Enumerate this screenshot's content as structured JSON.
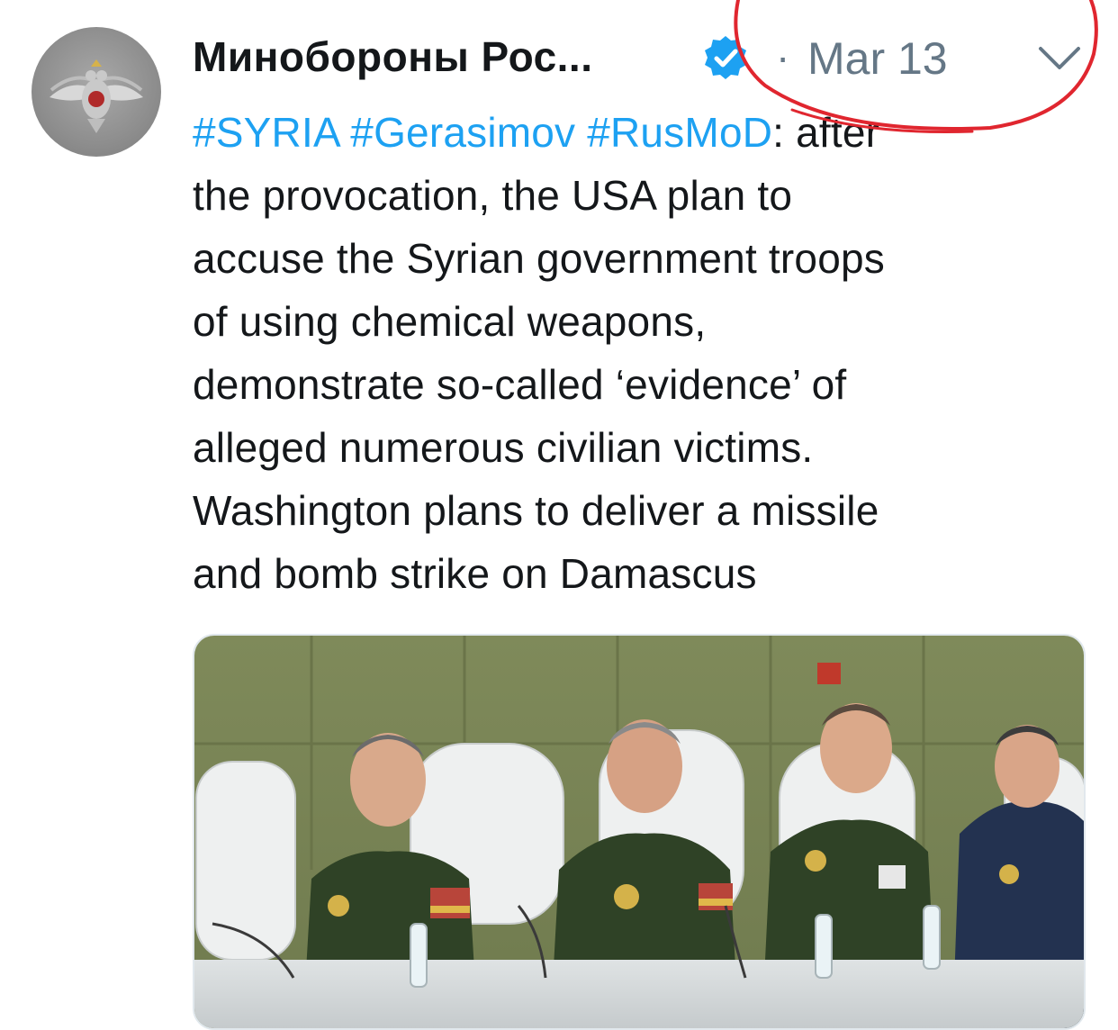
{
  "tweet": {
    "author": {
      "display_name": "Минобороны Рос...",
      "avatar_icon": "emblem-icon",
      "verified_icon": "verified-badge-icon"
    },
    "separator": "·",
    "date": "Mar 13",
    "menu_icon": "chevron-down-icon",
    "hashtags": [
      "#SYRIA",
      "#Gerasimov",
      "#RusMoD"
    ],
    "text_lines": [
      ": after",
      "the provocation, the USA plan to",
      "accuse the Syrian government troops",
      "of using chemical weapons,",
      "demonstrate so-called ‘evidence’ of",
      "alleged numerous civilian victims.",
      "Washington plans to deliver a missile",
      "and bomb strike on Damascus"
    ],
    "media": {
      "type": "photo",
      "icon": "photo-image"
    }
  },
  "colors": {
    "hashtag": "#1da1f2",
    "meta_gray": "#657786",
    "annotation_red": "#e0262f",
    "wall_green": "#7f8a5a"
  }
}
